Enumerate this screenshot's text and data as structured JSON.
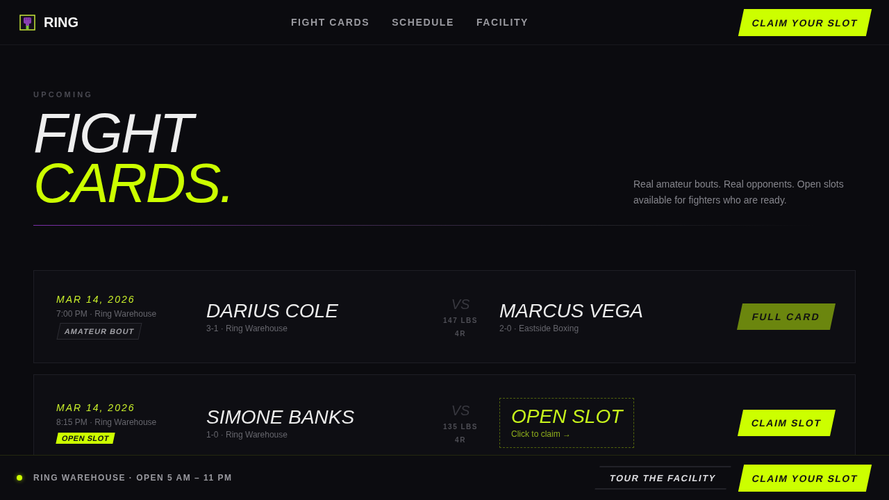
{
  "header": {
    "brand": "RING",
    "nav": [
      {
        "label": "FIGHT CARDS"
      },
      {
        "label": "SCHEDULE"
      },
      {
        "label": "FACILITY"
      }
    ],
    "cta": "CLAIM YOUR SLOT"
  },
  "hero": {
    "eyebrow": "UPCOMING",
    "title": "FIGHT",
    "title_accent": "CARDS.",
    "description": "Real amateur bouts. Real opponents. Open slots available for fighters who are ready."
  },
  "fights": [
    {
      "date": "MAR 14, 2026",
      "time": "7:00 PM · Ring Warehouse",
      "tag": {
        "label": "AMATEUR BOUT",
        "kind": "outline"
      },
      "corner_a": {
        "kind": "fighter",
        "name": "DARIUS COLE",
        "record": "3-1 · Ring Warehouse"
      },
      "vs": "VS",
      "weight": "147 LBS",
      "rounds": "4R",
      "corner_b": {
        "kind": "fighter",
        "name": "MARCUS VEGA",
        "record": "2-0 · Eastside Boxing"
      },
      "action": {
        "label": "FULL CARD",
        "disabled": true
      }
    },
    {
      "date": "MAR 14, 2026",
      "time": "8:15 PM · Ring Warehouse",
      "tag": {
        "label": "OPEN SLOT",
        "kind": "highlight"
      },
      "corner_a": {
        "kind": "fighter",
        "name": "SIMONE BANKS",
        "record": "1-0 · Ring Warehouse"
      },
      "vs": "VS",
      "weight": "135 LBS",
      "rounds": "4R",
      "corner_b": {
        "kind": "open",
        "name": "OPEN SLOT",
        "hint": "Click to claim →"
      },
      "action": {
        "label": "CLAIM SLOT",
        "disabled": false
      }
    }
  ],
  "footer": {
    "status": "RING WAREHOUSE · OPEN 5 AM – 11 PM",
    "buttons": [
      {
        "label": "TOUR THE FACILITY",
        "kind": "ghost"
      },
      {
        "label": "CLAIM YOUR SLOT",
        "kind": "primary"
      }
    ]
  }
}
